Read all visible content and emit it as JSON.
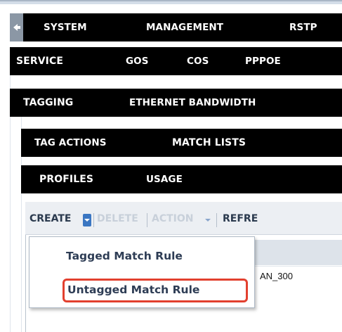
{
  "nav": {
    "row1": [
      "SYSTEM",
      "MANAGEMENT",
      "RSTP"
    ],
    "row2": [
      "SERVICE",
      "GOS",
      "COS",
      "PPPOE"
    ],
    "row3": [
      "TAGGING",
      "ETHERNET BANDWIDTH"
    ],
    "row4": [
      "TAG ACTIONS",
      "MATCH LISTS"
    ],
    "row5": [
      "PROFILES",
      "USAGE"
    ],
    "back_icon": "left-arrow-icon"
  },
  "toolbar": {
    "create_label": "CREATE",
    "delete_label": "DELETE",
    "action_label": "ACTION",
    "refresh_label": "REFRE"
  },
  "menu": {
    "items": [
      "Tagged Match Rule",
      "Untagged Match Rule"
    ]
  },
  "table": {
    "cell_value": "AN_300"
  },
  "colors": {
    "nav_bg": "#000000",
    "highlight": "#e2402f",
    "menu_text": "#2e3d55"
  }
}
